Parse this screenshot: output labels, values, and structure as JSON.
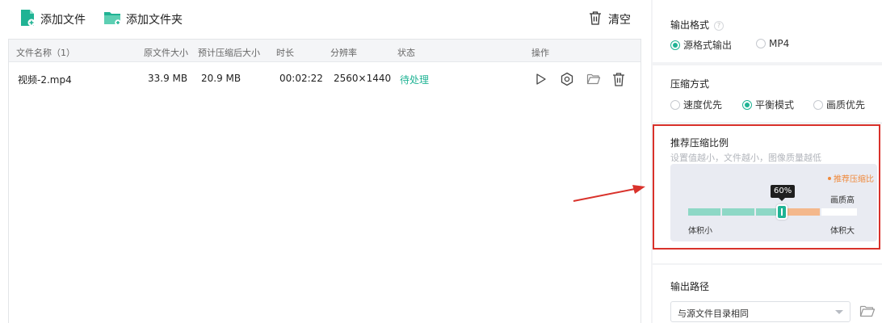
{
  "toolbar": {
    "add_file_label": "添加文件",
    "add_folder_label": "添加文件夹",
    "clear_label": "清空"
  },
  "table": {
    "headers": [
      "文件名称（1）",
      "原文件大小",
      "预计压缩后大小",
      "时长",
      "分辨率",
      "状态",
      "操作"
    ],
    "rows": [
      {
        "name": "视频-2.mp4",
        "orig_size": "33.9 MB",
        "est_size": "20.9 MB",
        "duration": "00:02:22",
        "resolution": "2560×1440",
        "status": "待处理"
      }
    ]
  },
  "output_format": {
    "title": "输出格式",
    "help": "?",
    "options": [
      "源格式输出",
      "MP4"
    ],
    "selected": "源格式输出"
  },
  "compress_mode": {
    "title": "压缩方式",
    "options": [
      "速度优先",
      "平衡模式",
      "画质优先"
    ],
    "selected": "平衡模式"
  },
  "ratio": {
    "title": "推荐压缩比例",
    "subtitle": "设置值越小，文件越小，图像质量越低",
    "legend": "推荐压缩比",
    "value_label": "60%",
    "value": 0.6,
    "quality_high": "画质高",
    "size_small": "体积小",
    "size_large": "体积大"
  },
  "output_path": {
    "title": "输出路径",
    "value": "与源文件目录相同"
  },
  "colors": {
    "accent": "#20b394",
    "recommend": "#f4a36b",
    "annotation": "#d9322b"
  }
}
